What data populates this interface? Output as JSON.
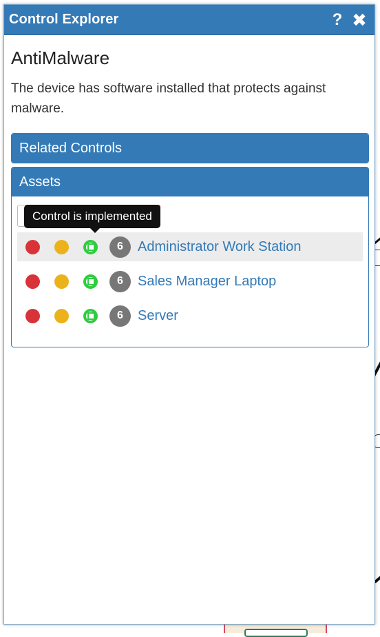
{
  "panel": {
    "title": "Control Explorer",
    "help_icon": "question-icon",
    "close_icon": "close-icon",
    "help_glyph": "?",
    "close_glyph": "✖"
  },
  "control": {
    "name": "AntiMalware",
    "description": "The device has software installed that protects against malware."
  },
  "sections": {
    "related_controls_label": "Related Controls",
    "assets_label": "Assets"
  },
  "tooltip": {
    "text": "Control is implemented"
  },
  "assets": [
    {
      "name": "Administrator Work Station",
      "count": "6",
      "hover": true
    },
    {
      "name": "Sales Manager Laptop",
      "count": "6",
      "hover": false
    },
    {
      "name": "Server",
      "count": "6",
      "hover": false
    }
  ],
  "colors": {
    "header_blue": "#337ab7",
    "status_red": "#d9333a",
    "status_yellow": "#ebb21c",
    "status_green": "#2ecc40",
    "badge_gray": "#777777",
    "filter_button_red": "#d9141f"
  }
}
